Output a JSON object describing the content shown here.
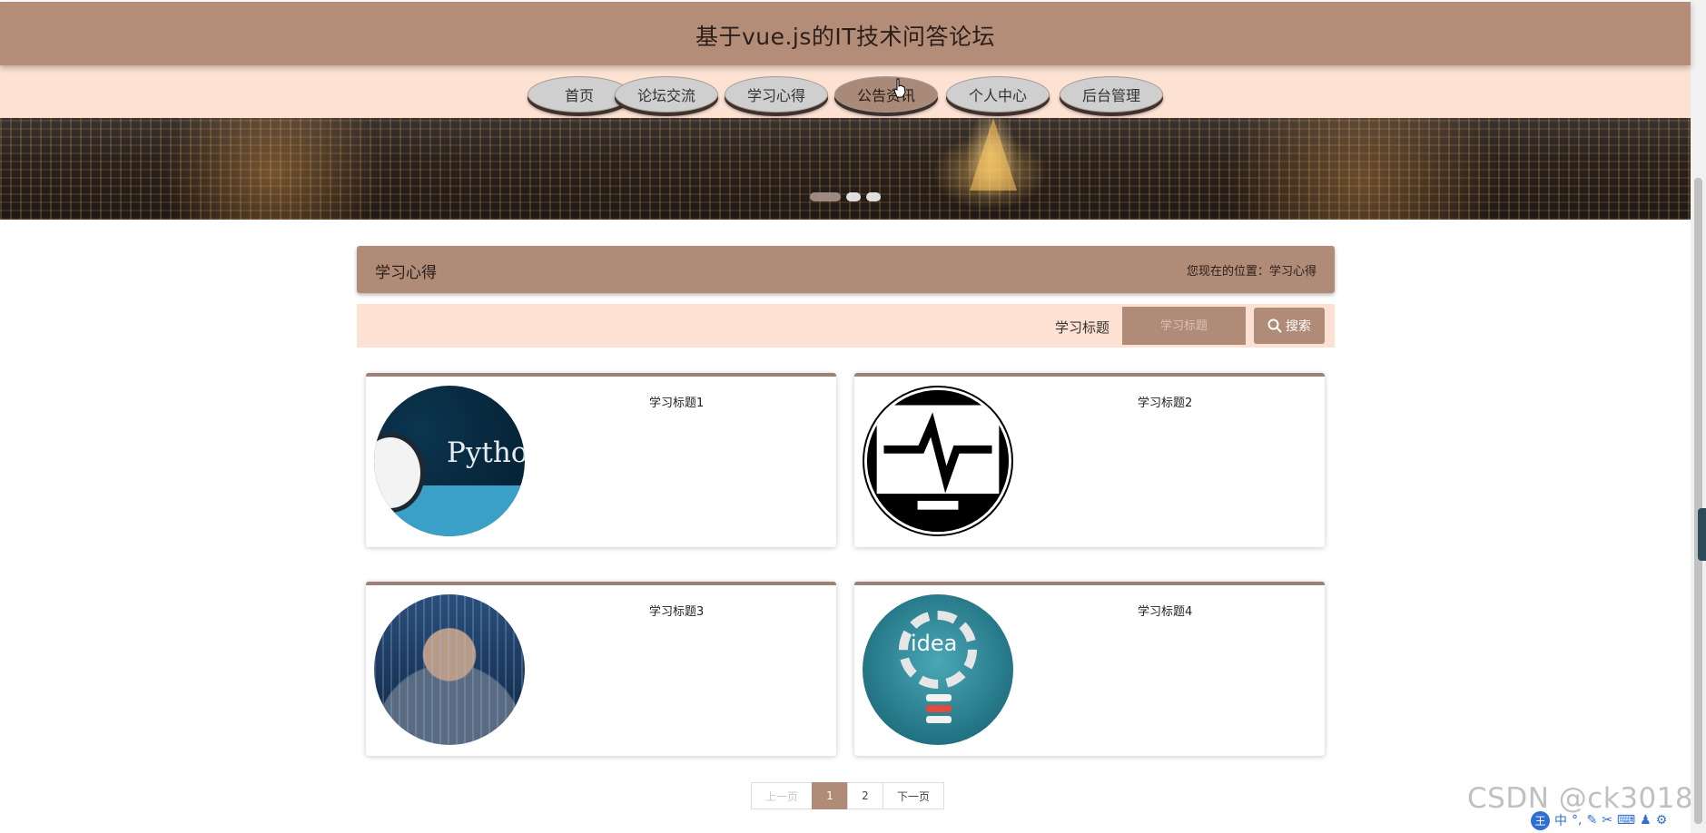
{
  "header": {
    "title": "基于vue.js的IT技术问答论坛"
  },
  "nav": {
    "items": [
      {
        "label": "首页"
      },
      {
        "label": "论坛交流"
      },
      {
        "label": "学习心得"
      },
      {
        "label": "公告资讯"
      },
      {
        "label": "个人中心"
      },
      {
        "label": "后台管理"
      }
    ],
    "active_index": 3
  },
  "section": {
    "title": "学习心得",
    "breadcrumb": "您现在的位置：学习心得"
  },
  "search": {
    "label": "学习标题",
    "placeholder": "学习标题",
    "button_label": "搜索"
  },
  "cards": [
    {
      "title": "学习标题1",
      "image_icon": "python-icon"
    },
    {
      "title": "学习标题2",
      "image_icon": "monitor-heartbeat-icon"
    },
    {
      "title": "学习标题3",
      "image_icon": "programmer-photo"
    },
    {
      "title": "学习标题4",
      "image_icon": "idea-bulb-icon"
    }
  ],
  "pagination": {
    "prev_label": "上一页",
    "pages": [
      "1",
      "2"
    ],
    "current_page": "1",
    "next_label": "下一页"
  },
  "watermark": "CSDN @ck3018",
  "taskbar": {
    "ime_logo": "王",
    "ime_mode": "中"
  },
  "colors": {
    "header_bg": "#b48d79",
    "nav_bg": "#fde1d3",
    "accent": "#b08b78"
  }
}
